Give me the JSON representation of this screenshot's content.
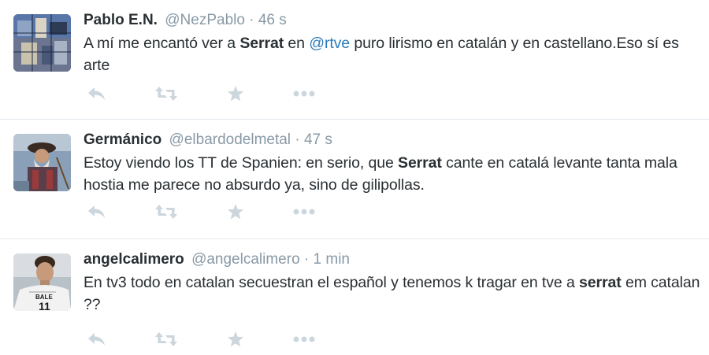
{
  "tweets": [
    {
      "fullname": "Pablo E.N.",
      "username": "@NezPablo",
      "separator": "·",
      "time": "46 s",
      "text": {
        "p1": "A mí me encantó ver a ",
        "b1": "Serrat",
        "p2": " en ",
        "mention": "@rtve",
        "p3": " puro lirismo en catalán y en castellano.Eso sí es arte"
      }
    },
    {
      "fullname": "Germánico",
      "username": "@elbardodelmetal",
      "separator": "·",
      "time": "47 s",
      "text": {
        "p1": "Estoy viendo los TT de Spanien: en serio, que ",
        "b1": "Serrat",
        "p2": " cante en catalá levante tanta mala hostia me parece no absurdo ya, sino de gilipollas."
      }
    },
    {
      "fullname": "angelcalimero",
      "username": "@angelcalimero",
      "separator": "·",
      "time": "1 min",
      "text": {
        "p1": "En tv3 todo en catalan secuestran el español y tenemos k tragar en tve a ",
        "b1": "serrat",
        "p2": " em catalan ??"
      },
      "avatar_text": "BALE"
    }
  ],
  "actions": [
    "reply-icon",
    "retweet-icon",
    "favorite-icon",
    "more-icon"
  ],
  "colors": {
    "name": "#292f33",
    "meta": "#8899a6",
    "link": "#2b7bb9",
    "icon": "#ccd6dd",
    "divider": "#e1e8ed"
  }
}
